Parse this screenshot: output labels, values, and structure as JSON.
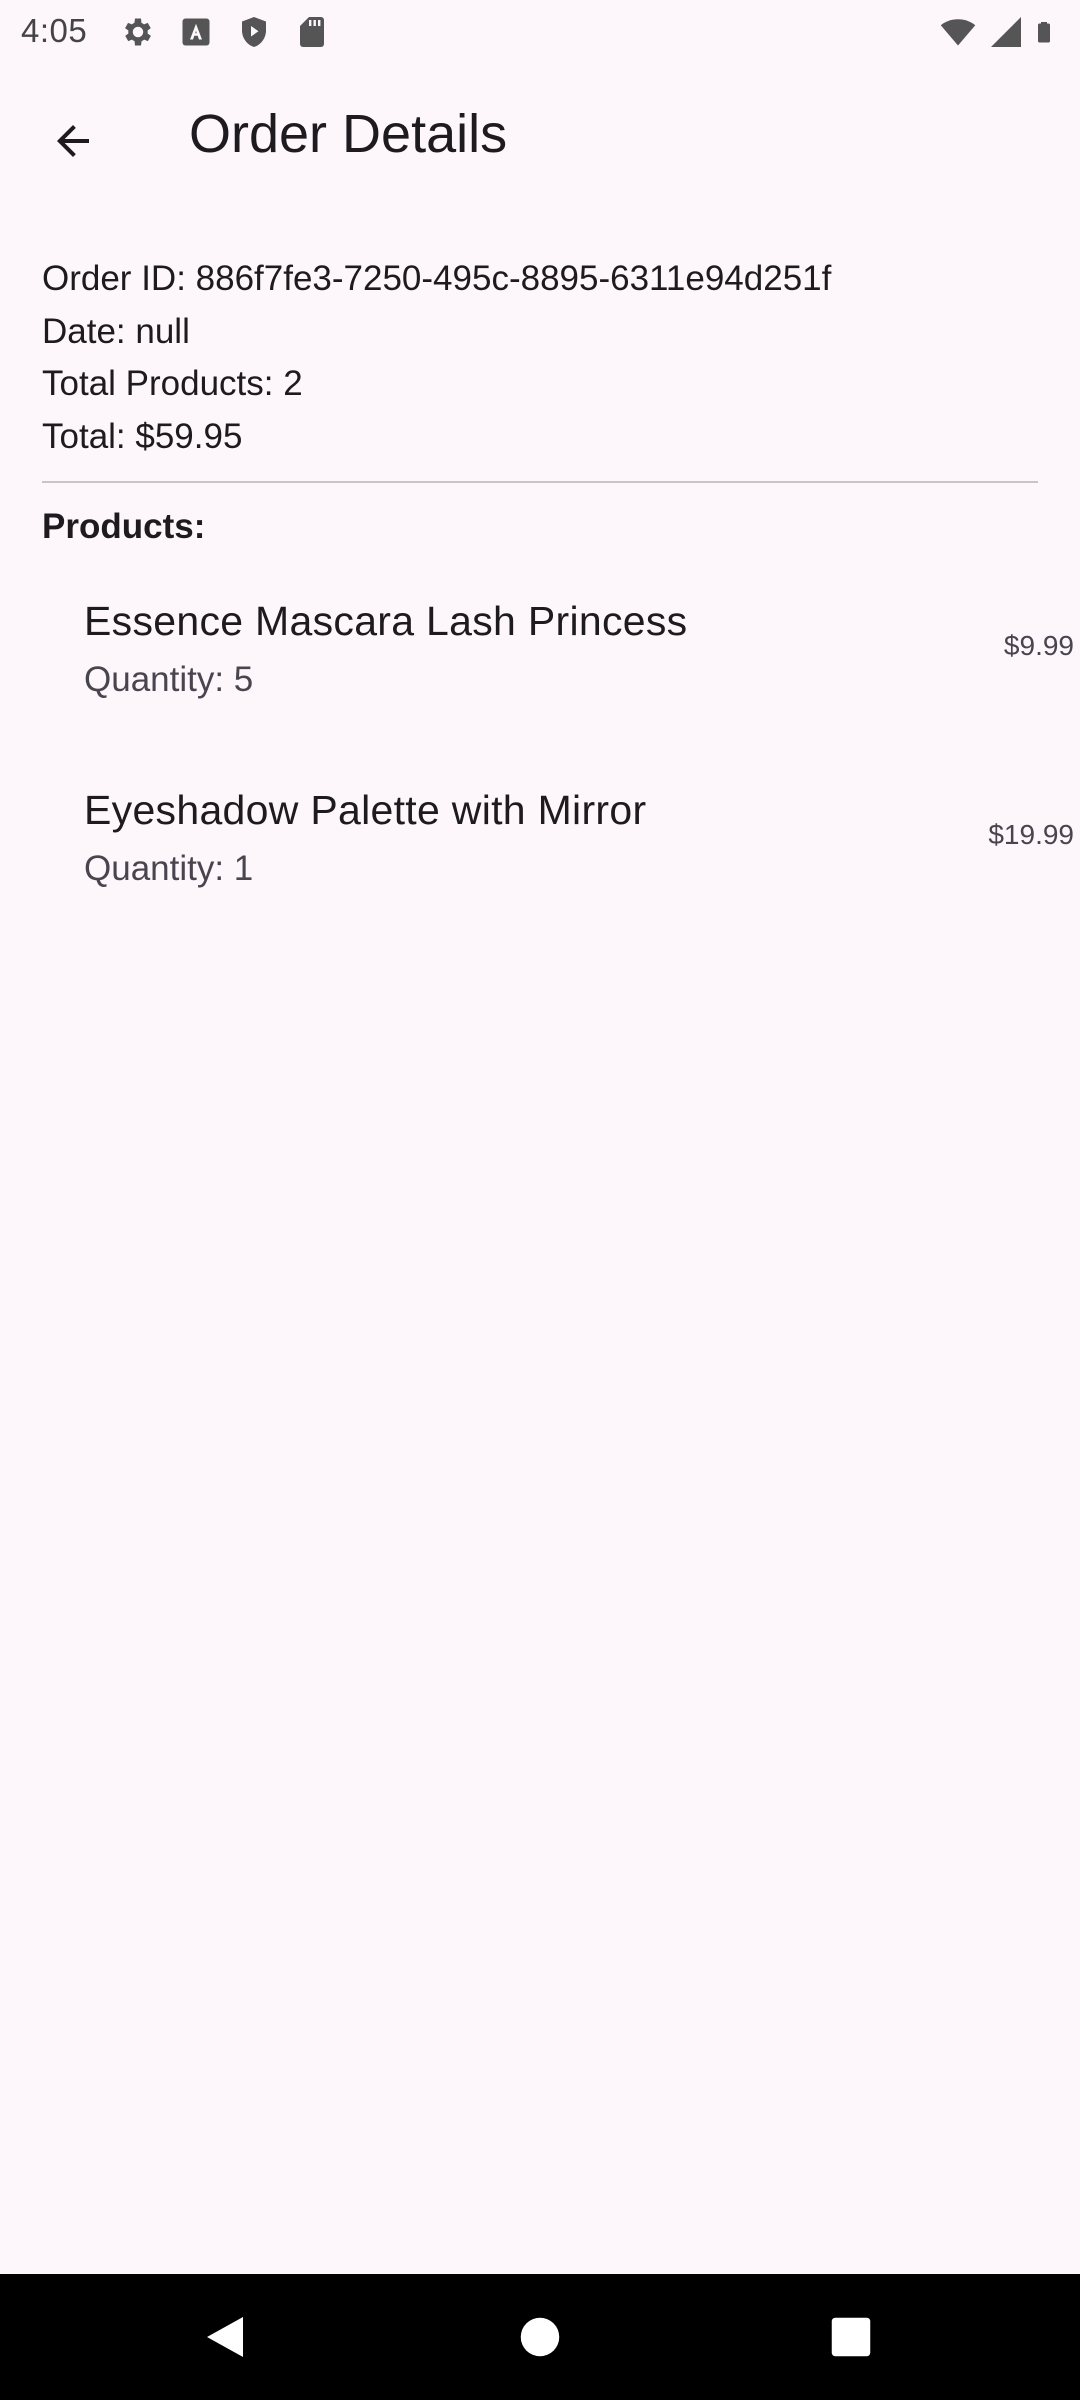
{
  "status_bar": {
    "time": "4:05",
    "left_icons": [
      "settings-icon",
      "font-a-icon",
      "shield-icon",
      "sd-card-icon"
    ],
    "right_icons": [
      "wifi-icon",
      "signal-icon",
      "battery-icon"
    ]
  },
  "app_bar": {
    "title": "Order Details",
    "back_icon": "arrow-back-icon"
  },
  "order": {
    "id_line": "Order ID: 886f7fe3-7250-495c-8895-6311e94d251f",
    "date_line": "Date: null",
    "total_products_line": "Total Products: 2",
    "total_line": "Total: $59.95"
  },
  "products_heading": "Products:",
  "products": [
    {
      "name": "Essence Mascara Lash Princess",
      "quantity": "Quantity: 5",
      "price": "$9.99"
    },
    {
      "name": "Eyeshadow Palette with Mirror",
      "quantity": "Quantity: 1",
      "price": "$19.99"
    }
  ],
  "nav_bar": {
    "buttons": [
      "back-triangle-icon",
      "home-circle-icon",
      "recents-square-icon"
    ]
  },
  "colors": {
    "background": "#fdf7fc",
    "text_primary": "#1d1b20",
    "text_secondary": "#49454f",
    "divider": "#c9c4cc",
    "nav_bar": "#000000"
  }
}
